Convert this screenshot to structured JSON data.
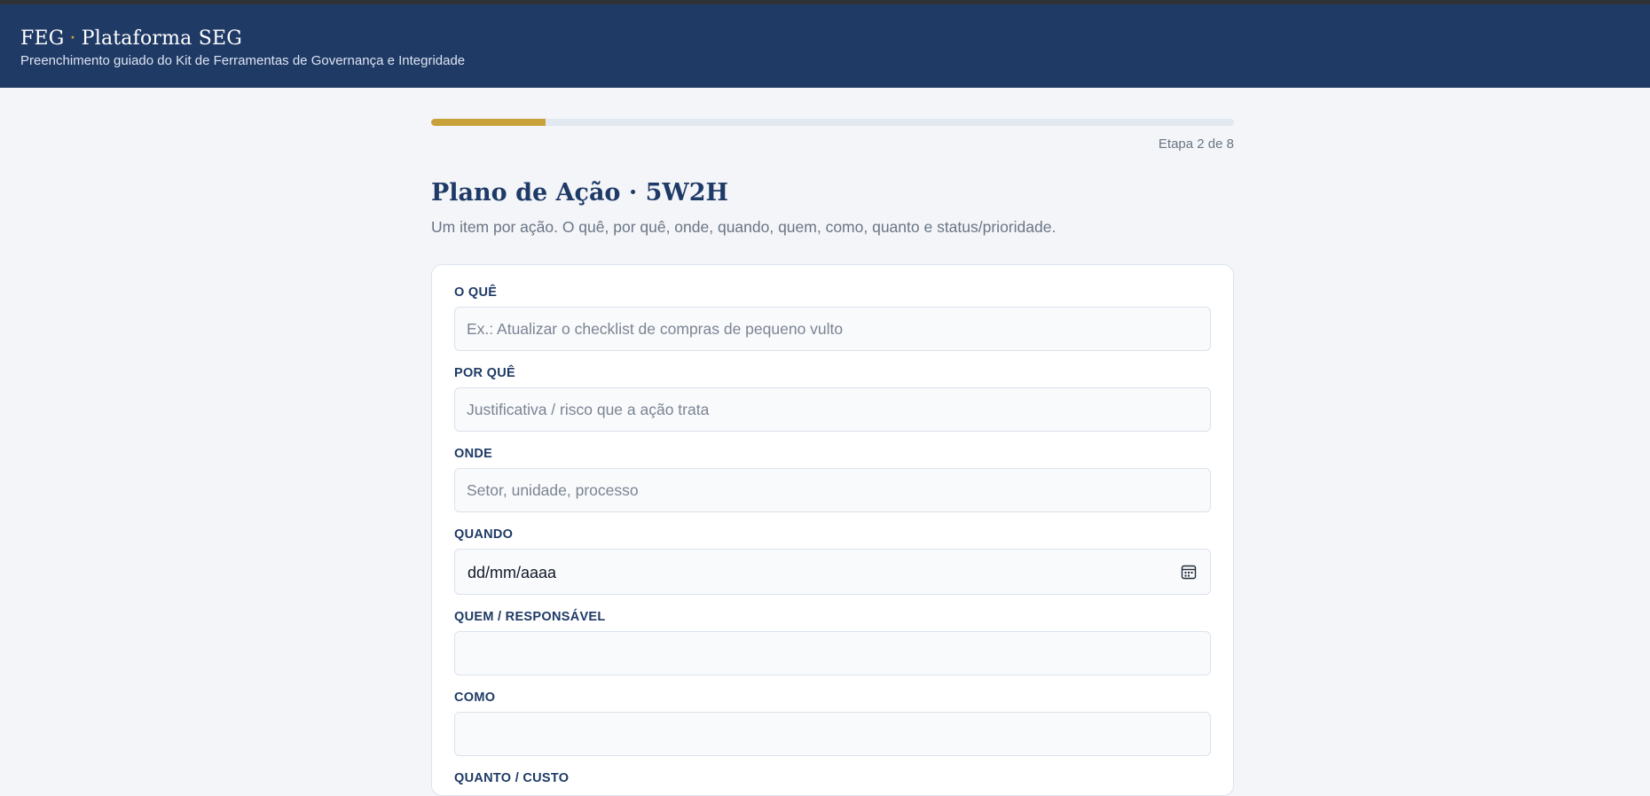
{
  "header": {
    "brand_left": "FEG",
    "brand_sep": "·",
    "brand_right": "Plataforma SEG",
    "subtitle": "Preenchimento guiado do Kit de Ferramentas de Governança e Integridade"
  },
  "progress": {
    "fraction": 0.142,
    "label": "Etapa 2 de 8"
  },
  "page": {
    "title": "Plano de Ação · 5W2H",
    "description": "Um item por ação. O quê, por quê, onde, quando, quem, como, quanto e status/prioridade."
  },
  "form": {
    "o_que": {
      "label": "O QUÊ",
      "placeholder": "Ex.: Atualizar o checklist de compras de pequeno vulto",
      "value": ""
    },
    "por_que": {
      "label": "POR QUÊ",
      "placeholder": "Justificativa / risco que a ação trata",
      "value": ""
    },
    "onde": {
      "label": "ONDE",
      "placeholder": "Setor, unidade, processo",
      "value": ""
    },
    "quando": {
      "label": "QUANDO",
      "value": "dd/mm/aaaa"
    },
    "quem": {
      "label": "QUEM / RESPONSÁVEL",
      "placeholder": "",
      "value": ""
    },
    "como": {
      "label": "COMO",
      "placeholder": "",
      "value": ""
    },
    "quanto": {
      "label": "QUANTO / CUSTO"
    }
  },
  "colors": {
    "header_bg": "#203a66",
    "accent_gold": "#c9a13a",
    "title_navy": "#1e3a66",
    "page_bg": "#f3f5f9"
  },
  "icons": {
    "date": "calendar-icon"
  }
}
